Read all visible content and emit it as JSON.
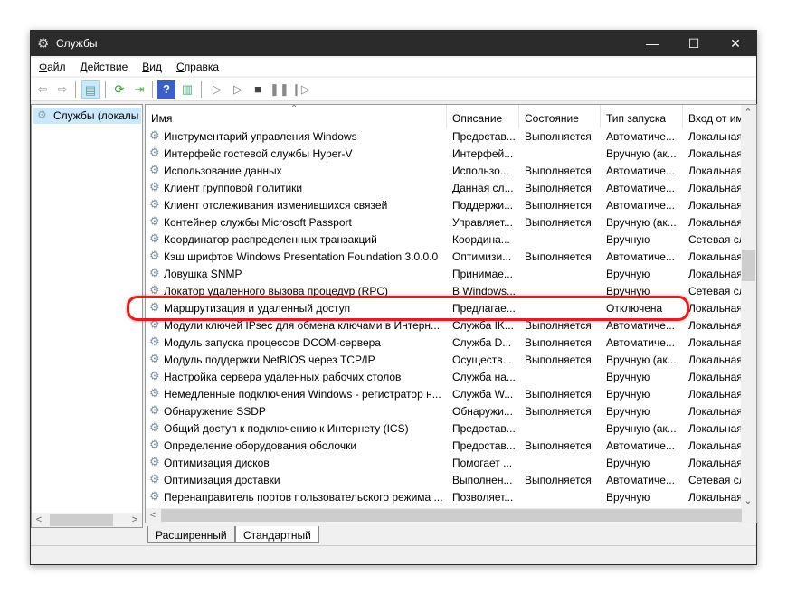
{
  "window": {
    "title": "Службы"
  },
  "menu": [
    {
      "u": "Ф",
      "rest": "айл"
    },
    {
      "u": "Д",
      "rest": "ействие"
    },
    {
      "u": "В",
      "rest": "ид"
    },
    {
      "u": "С",
      "rest": "правка"
    }
  ],
  "left_pane": {
    "item": "Службы (локалы"
  },
  "columns": [
    "Имя",
    "Описание",
    "Состояние",
    "Тип запуска",
    "Вход от им"
  ],
  "rows": [
    [
      "Инструментарий управления Windows",
      "Предостав...",
      "Выполняется",
      "Автоматиче...",
      "Локальная"
    ],
    [
      "Интерфейс гостевой службы Hyper-V",
      "Интерфей...",
      "",
      "Вручную (ак...",
      "Локальная"
    ],
    [
      "Использование данных",
      "Использо...",
      "Выполняется",
      "Автоматиче...",
      "Локальная"
    ],
    [
      "Клиент групповой политики",
      "Данная сл...",
      "Выполняется",
      "Автоматиче...",
      "Локальная"
    ],
    [
      "Клиент отслеживания изменившихся связей",
      "Поддержи...",
      "Выполняется",
      "Автоматиче...",
      "Локальная"
    ],
    [
      "Контейнер службы Microsoft Passport",
      "Управляет...",
      "Выполняется",
      "Вручную (ак...",
      "Локальная"
    ],
    [
      "Координатор распределенных транзакций",
      "Координа...",
      "",
      "Вручную",
      "Сетевая сл"
    ],
    [
      "Кэш шрифтов Windows Presentation Foundation 3.0.0.0",
      "Оптимизи...",
      "Выполняется",
      "Автоматиче...",
      "Локальная"
    ],
    [
      "Ловушка SNMP",
      "Принимае...",
      "",
      "Вручную",
      "Локальная"
    ],
    [
      "Локатор удаленного вызова процедур (RPC)",
      "В Windows...",
      "",
      "Вручную",
      "Сетевая сл"
    ],
    [
      "Маршрутизация и удаленный доступ",
      "Предлагае...",
      "",
      "Отключена",
      "Локальная"
    ],
    [
      "Модули ключей IPsec для обмена ключами в Интерн...",
      "Служба IK...",
      "Выполняется",
      "Автоматиче...",
      "Локальная"
    ],
    [
      "Модуль запуска процессов DCOM-сервера",
      "Служба D...",
      "Выполняется",
      "Автоматиче...",
      "Локальная"
    ],
    [
      "Модуль поддержки NetBIOS через TCP/IP",
      "Осуществ...",
      "Выполняется",
      "Вручную (ак...",
      "Локальная"
    ],
    [
      "Настройка сервера удаленных рабочих столов",
      "Служба на...",
      "",
      "Вручную",
      "Локальная"
    ],
    [
      "Немедленные подключения Windows - регистратор н...",
      "Служба W...",
      "Выполняется",
      "Вручную",
      "Локальная"
    ],
    [
      "Обнаружение SSDP",
      "Обнаружи...",
      "Выполняется",
      "Вручную",
      "Локальная"
    ],
    [
      "Общий доступ к подключению к Интернету (ICS)",
      "Предостав...",
      "",
      "Вручную (ак...",
      "Локальная"
    ],
    [
      "Определение оборудования оболочки",
      "Предостав...",
      "Выполняется",
      "Автоматиче...",
      "Локальная"
    ],
    [
      "Оптимизация дисков",
      "Помогает ...",
      "",
      "Вручную",
      "Локальная"
    ],
    [
      "Оптимизация доставки",
      "Выполнен...",
      "Выполняется",
      "Автоматиче...",
      "Сетевая сл"
    ],
    [
      "Перенаправитель портов пользовательского режима ...",
      "Позволяет...",
      "",
      "Вручную",
      "Локальная"
    ]
  ],
  "tabs": [
    "Расширенный",
    "Стандартный"
  ],
  "highlight_color": "#e02020"
}
